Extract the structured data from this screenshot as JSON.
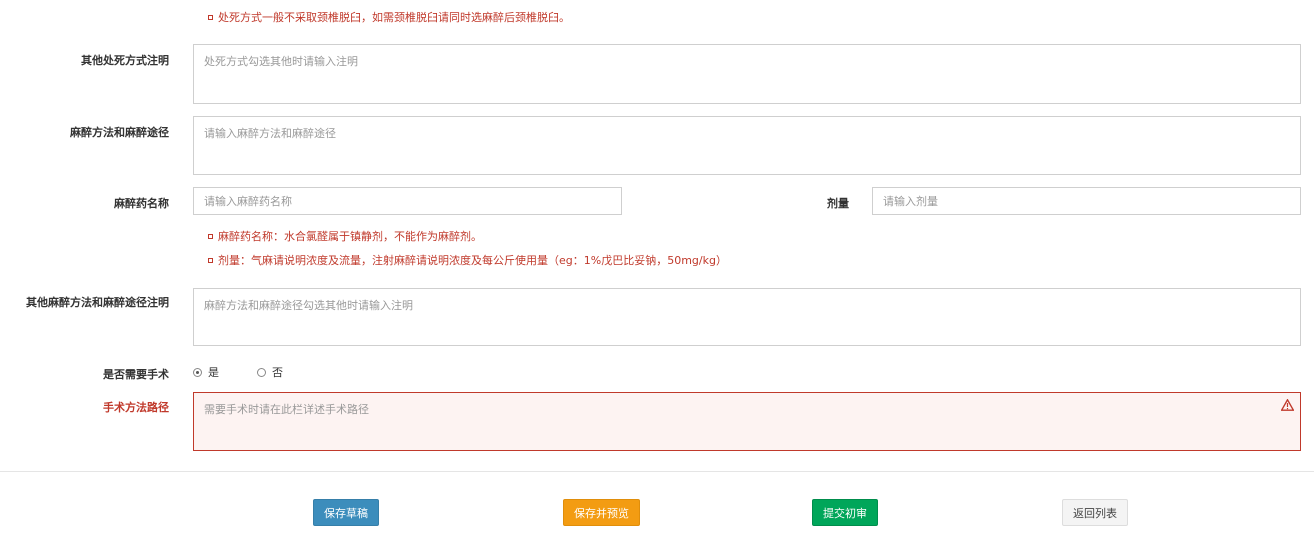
{
  "notes": {
    "execution": "处死方式一般不采取颈椎脱臼，如需颈椎脱臼请同时选麻醉后颈椎脱臼。",
    "anesthetic_name": "麻醉药名称：水合氯醛属于镇静剂，不能作为麻醉剂。",
    "dose": "剂量：气麻请说明浓度及流量，注射麻醉请说明浓度及每公斤使用量（eg：1%戊巴比妥钠，50mg/kg）"
  },
  "fields": {
    "other_execution": {
      "label": "其他处死方式注明",
      "placeholder": "处死方式勾选其他时请输入注明"
    },
    "anesthesia_method": {
      "label": "麻醉方法和麻醉途径",
      "placeholder": "请输入麻醉方法和麻醉途径"
    },
    "anesthetic_name": {
      "label": "麻醉药名称",
      "placeholder": "请输入麻醉药名称"
    },
    "dose": {
      "label": "剂量",
      "placeholder": "请输入剂量"
    },
    "other_anesthesia": {
      "label": "其他麻醉方法和麻醉途径注明",
      "placeholder": "麻醉方法和麻醉途径勾选其他时请输入注明"
    },
    "surgery_needed": {
      "label": "是否需要手术",
      "options": [
        "是",
        "否"
      ],
      "selected": "是"
    },
    "surgery_path": {
      "label": "手术方法路径",
      "placeholder": "需要手术时请在此栏详述手术路径"
    }
  },
  "buttons": {
    "save_draft": "保存草稿",
    "save_preview": "保存并预览",
    "submit_review": "提交初审",
    "back_list": "返回列表"
  },
  "colors": {
    "error": "#c0392b",
    "primary": "#3c8dbc",
    "warning": "#f39c12",
    "success": "#00a65a"
  },
  "icons": {
    "error": "warning-icon",
    "radio": "radio-icon"
  }
}
